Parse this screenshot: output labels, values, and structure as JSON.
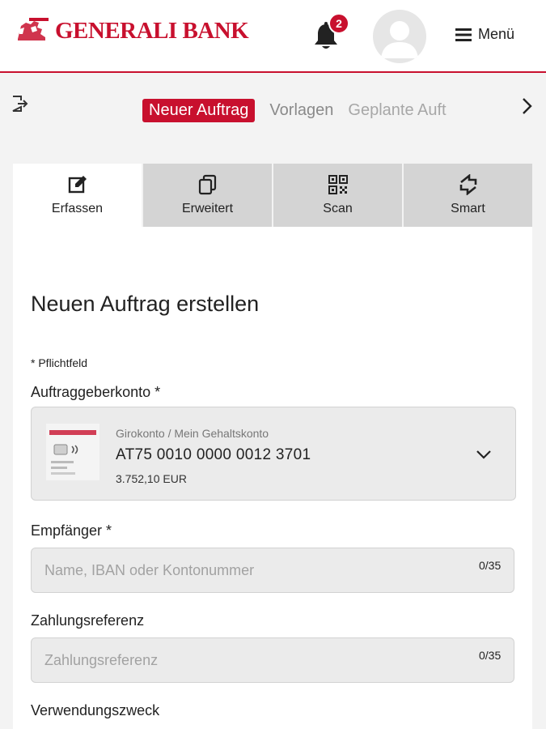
{
  "header": {
    "logo_text": "GENERALI BANK",
    "notification_count": "2",
    "menu_label": "Menü"
  },
  "subnav": {
    "tabs": [
      {
        "label": "Neuer Auftrag",
        "active": true
      },
      {
        "label": "Vorlagen",
        "active": false
      },
      {
        "label": "Geplante Auft",
        "active": false
      }
    ]
  },
  "mode_tabs": [
    {
      "label": "Erfassen",
      "icon": "edit-icon",
      "active": true
    },
    {
      "label": "Erweitert",
      "icon": "copy-icon",
      "active": false
    },
    {
      "label": "Scan",
      "icon": "qr-code-icon",
      "active": false
    },
    {
      "label": "Smart",
      "icon": "swap-arrows-icon",
      "active": false
    }
  ],
  "form": {
    "title": "Neuen Auftrag erstellen",
    "required_note": "* Pflichtfeld",
    "account": {
      "label": "Auftraggeberkonto *",
      "type": "Girokonto / Mein Gehaltskonto",
      "iban": "AT75 0010 0000 0012 3701",
      "balance": "3.752,10 EUR"
    },
    "recipient": {
      "label": "Empfänger *",
      "placeholder": "Name, IBAN oder Kontonummer",
      "counter": "0/35"
    },
    "reference": {
      "label": "Zahlungsreferenz",
      "placeholder": "Zahlungsreferenz",
      "counter": "0/35"
    },
    "purpose": {
      "label": "Verwendungszweck"
    }
  },
  "colors": {
    "brand_red": "#c8102e",
    "tab_inactive": "#d4d4d4",
    "field_bg": "#ebebeb",
    "page_bg": "#f3f3f3"
  }
}
